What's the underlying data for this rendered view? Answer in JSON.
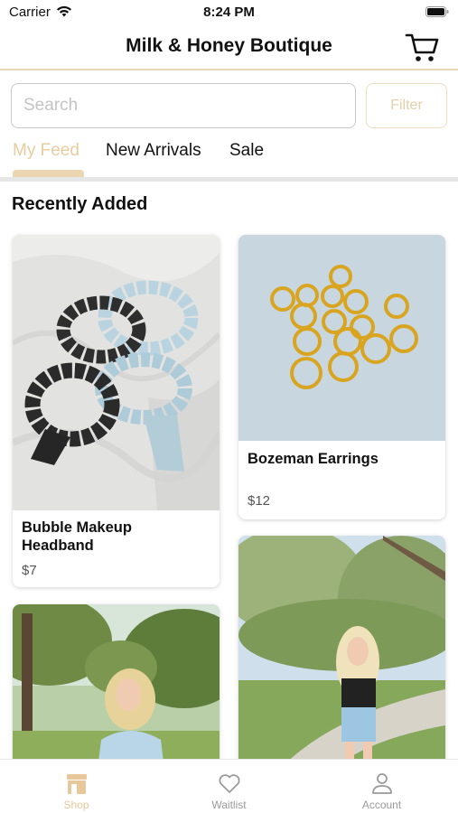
{
  "status_bar": {
    "carrier": "Carrier",
    "time": "8:24 PM"
  },
  "header": {
    "title": "Milk & Honey Boutique",
    "cart_icon": "cart-icon"
  },
  "search": {
    "placeholder": "Search",
    "value": ""
  },
  "filter_label": "Filter",
  "tabs": [
    {
      "label": "My Feed",
      "active": true
    },
    {
      "label": "New Arrivals",
      "active": false
    },
    {
      "label": "Sale",
      "active": false
    }
  ],
  "section_title": "Recently Added",
  "products": [
    {
      "name": "Bubble Makeup Headband",
      "price": "$7"
    },
    {
      "name": "Bozeman Earrings",
      "price": "$12"
    },
    {
      "name": "",
      "price": ""
    },
    {
      "name": "",
      "price": ""
    }
  ],
  "tab_bar": [
    {
      "label": "Shop",
      "icon": "store-icon",
      "active": true
    },
    {
      "label": "Waitlist",
      "icon": "heart-icon",
      "active": false
    },
    {
      "label": "Account",
      "icon": "person-icon",
      "active": false
    }
  ],
  "colors": {
    "accent": "#e8cc9f",
    "accent_border": "#ecdcc0",
    "tab_inactive": "#9a9a9a"
  }
}
